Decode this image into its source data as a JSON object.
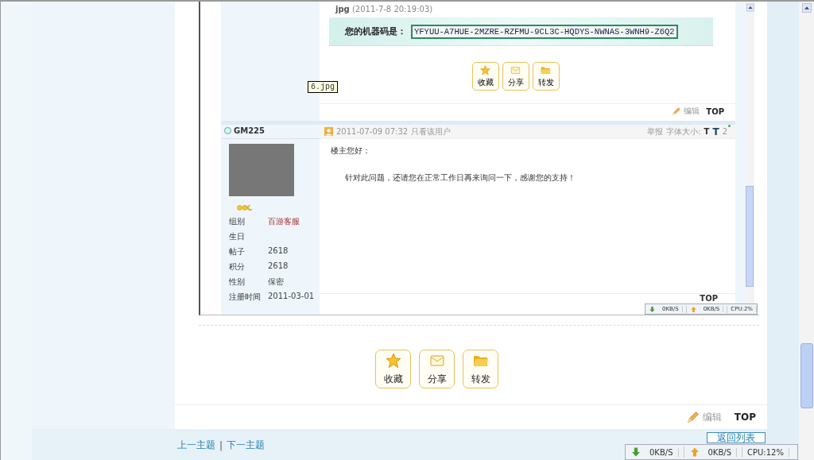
{
  "embedded_screenshot": {
    "attachment": {
      "name": "jpg",
      "time": "(2011-7-8 20:19:03)"
    },
    "machine_code": {
      "label": "您的机器码是：",
      "value": "YFYUU-A7HUE-2MZRE-RZFMU-9CL3C-HQDYS-NWNAS-3WNH9-Z6Q2"
    },
    "actions": [
      {
        "kind": "star",
        "label": "收藏"
      },
      {
        "kind": "envelope",
        "label": "分享"
      },
      {
        "kind": "folder",
        "label": "转发"
      }
    ],
    "tooltip": "6.jpg",
    "post_tools": {
      "edit": "编辑",
      "top": "TOP"
    },
    "post": {
      "author": "GM225",
      "date": "2011-07-09 07:32",
      "only_author": "只看该用户",
      "report": "举报",
      "font_size_label": "字体大小:",
      "font_small": "T",
      "font_large": "T",
      "floor": "2",
      "greeting": "楼主您好：",
      "body": "针对此问题，还请您在正常工作日再来询问一下，感谢您的支持！",
      "profile": [
        {
          "label": "组别",
          "value": "百游客服",
          "kind": "group"
        },
        {
          "label": "生日",
          "kind": "plain"
        },
        {
          "label": "帖子",
          "value": "2618",
          "kind": "plain"
        },
        {
          "label": "积分",
          "value": "2618",
          "kind": "plain"
        },
        {
          "label": "性别",
          "value": "保密",
          "kind": "plain"
        },
        {
          "label": "注册时间",
          "value": "2011-03-01",
          "kind": "plain"
        }
      ],
      "top": "TOP"
    },
    "status_bar": {
      "download": "0KB/S",
      "upload": "0KB/S",
      "cpu": "CPU:2%"
    }
  },
  "actions": [
    {
      "kind": "star",
      "label": "收藏"
    },
    {
      "kind": "envelope",
      "label": "分享"
    },
    {
      "kind": "folder",
      "label": "转发"
    }
  ],
  "post_tools": {
    "edit": "编辑",
    "top": "TOP"
  },
  "nav": {
    "prev": "上一主题",
    "separator": "|",
    "next": "下一主题",
    "back": "返回列表"
  },
  "status_bar": {
    "download": "0KB/S",
    "upload": "0KB/S",
    "cpu": "CPU:12%"
  }
}
